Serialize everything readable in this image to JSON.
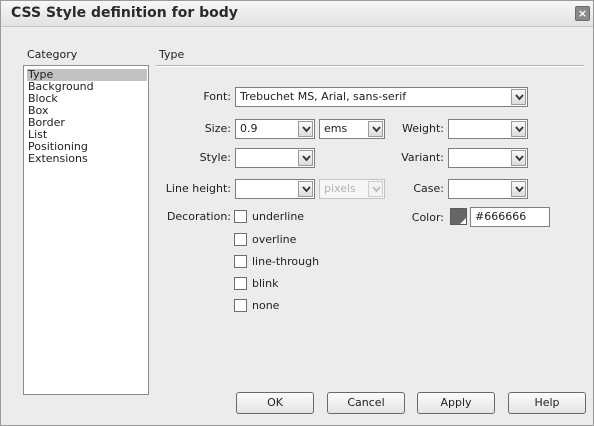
{
  "window": {
    "title": "CSS Style definition for body",
    "close_glyph": "×"
  },
  "category": {
    "heading": "Category",
    "items": [
      {
        "label": "Type",
        "selected": true
      },
      {
        "label": "Background",
        "selected": false
      },
      {
        "label": "Block",
        "selected": false
      },
      {
        "label": "Box",
        "selected": false
      },
      {
        "label": "Border",
        "selected": false
      },
      {
        "label": "List",
        "selected": false
      },
      {
        "label": "Positioning",
        "selected": false
      },
      {
        "label": "Extensions",
        "selected": false
      }
    ]
  },
  "panel": {
    "heading": "Type"
  },
  "form": {
    "font": {
      "label": "Font:",
      "value": "Trebuchet MS, Arial, sans-serif"
    },
    "size": {
      "label": "Size:",
      "value": "0.9",
      "unit": "ems"
    },
    "weight": {
      "label": "Weight:",
      "value": ""
    },
    "style": {
      "label": "Style:",
      "value": ""
    },
    "variant": {
      "label": "Variant:",
      "value": ""
    },
    "line_height": {
      "label": "Line height:",
      "value": "",
      "unit": "pixels",
      "unit_disabled": true
    },
    "case": {
      "label": "Case:",
      "value": ""
    },
    "decoration": {
      "label": "Decoration:",
      "options": [
        {
          "label": "underline",
          "checked": false
        },
        {
          "label": "overline",
          "checked": false
        },
        {
          "label": "line-through",
          "checked": false
        },
        {
          "label": "blink",
          "checked": false
        },
        {
          "label": "none",
          "checked": false
        }
      ]
    },
    "color": {
      "label": "Color:",
      "value": "#666666",
      "swatch": "#666666"
    }
  },
  "buttons": {
    "ok": "OK",
    "cancel": "Cancel",
    "apply": "Apply",
    "help": "Help"
  }
}
